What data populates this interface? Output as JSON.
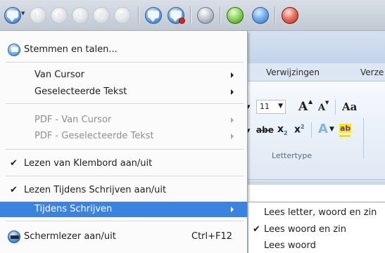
{
  "toolbar": {
    "icons": [
      "speech-menu-icon",
      "previous-icon",
      "play-icon",
      "pause-icon",
      "stop-icon",
      "volume-icon",
      "save-audio-icon",
      "record-icon",
      "keyboard-icon",
      "search-icon",
      "dictionary-icon",
      "flag-icon"
    ]
  },
  "background_app": {
    "tabs": {
      "references": "Verwijzingen",
      "partial": "Verze"
    },
    "font_size": "11",
    "grow_font": "A",
    "shrink_font": "A",
    "change_case": "Aa",
    "strikethrough": "abe",
    "subscript": "x",
    "subscript_mark": "2",
    "superscript": "x",
    "superscript_mark": "2",
    "highlight": "ab",
    "font_group_label": "Lettertype"
  },
  "menu": {
    "voices": "Stemmen en talen...",
    "from_cursor": "Van Cursor",
    "selected_text": "Geselecteerde Tekst",
    "pdf_from_cursor": "PDF - Van Cursor",
    "pdf_selected_text": "PDF - Geselecteerde Tekst",
    "read_clipboard": "Lezen van Klembord aan/uit",
    "read_while_typing": "Lezen Tijdens Schrijven aan/uit",
    "while_typing": "Tijdens Schrijven",
    "screen_reader": "Schermlezer aan/uit",
    "screen_reader_shortcut": "Ctrl+F12",
    "check_mark": "✔"
  },
  "submenu": {
    "items": [
      "Lees letter, woord en zin",
      "Lees woord en zin",
      "Lees woord"
    ],
    "checked_index": 1
  },
  "colors": {
    "selection": "#3a83e0",
    "menu_background": "#fbfbfb",
    "ribbon_background": "#dfe8f4"
  }
}
